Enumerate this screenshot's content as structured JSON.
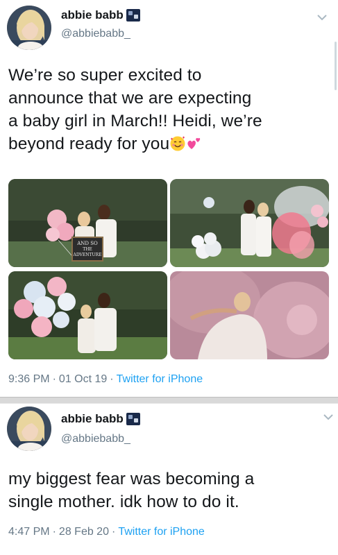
{
  "tweets": [
    {
      "display_name": "abbie babb",
      "handle": "@abbiebabb_",
      "text_lines": [
        "We’re so super excited to",
        "announce that we are expecting",
        "a baby girl in March!! Heidi, we’re",
        "beyond ready for you"
      ],
      "emojis": [
        "smiling-face-with-hearts",
        "two-hearts"
      ],
      "time": "9:36 PM",
      "date": "01 Oct 19",
      "source": "Twitter for iPhone",
      "photo_sign_text": "AND SO THE ADVENTURE BEGINS"
    },
    {
      "display_name": "abbie babb",
      "handle": "@abbiebabb_",
      "text_lines": [
        "my biggest fear was becoming a",
        "single mother. idk how to do it."
      ],
      "time": "4:47 PM",
      "date": "28 Feb 20",
      "source": "Twitter for iPhone"
    }
  ],
  "separator": "·",
  "colors": {
    "text": "#14171a",
    "secondary": "#657786",
    "link": "#1da1f2",
    "divider": "#d9d9d9"
  }
}
